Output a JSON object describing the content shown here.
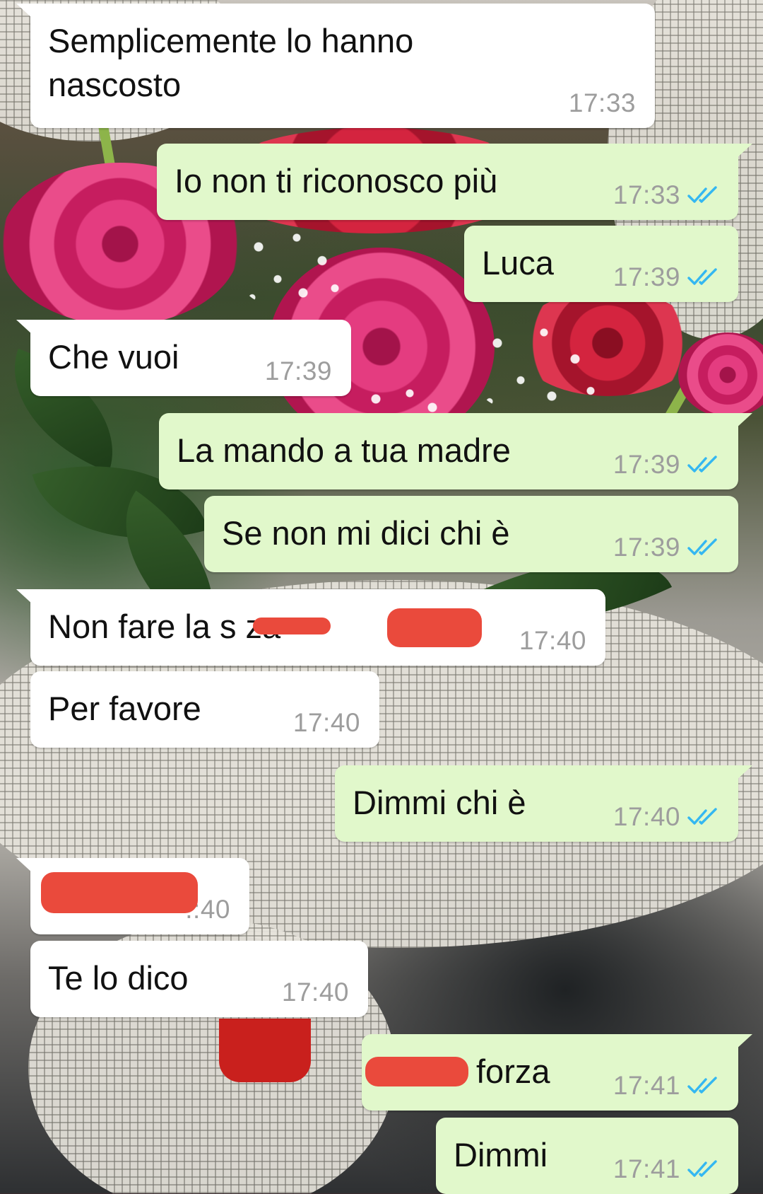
{
  "colors": {
    "incoming_bubble": "#ffffff",
    "outgoing_bubble": "#e1f8cb",
    "timestamp": "#9d9d9d",
    "read_ticks": "#34b7f1",
    "redaction": "#ea4a3c"
  },
  "icons": {
    "read_receipt": "double-check-icon"
  },
  "messages": [
    {
      "dir": "in",
      "text": "Semplicemente lo hanno\nnascosto",
      "time": "17:33"
    },
    {
      "dir": "out",
      "text": "Io non ti riconosco più",
      "time": "17:33",
      "read": true
    },
    {
      "dir": "out",
      "text": "Luca",
      "time": "17:39",
      "read": true
    },
    {
      "dir": "in",
      "text": "Che vuoi",
      "time": "17:39"
    },
    {
      "dir": "out",
      "text": "La mando a tua madre",
      "time": "17:39",
      "read": true
    },
    {
      "dir": "out",
      "text": "Se non mi dici chi è",
      "time": "17:39",
      "read": true
    },
    {
      "dir": "in",
      "text": "Non fare la s      za",
      "time": "17:40",
      "redacted": true
    },
    {
      "dir": "in",
      "text": "Per favore",
      "time": "17:40"
    },
    {
      "dir": "out",
      "text": "Dimmi chi è",
      "time": "17:40",
      "read": true
    },
    {
      "dir": "in",
      "text": "",
      "time": ".:40",
      "redacted": true
    },
    {
      "dir": "in",
      "text": "Te lo dico",
      "time": "17:40"
    },
    {
      "dir": "out",
      "text": "forza",
      "time": "17:41",
      "read": true,
      "redacted": true
    },
    {
      "dir": "out",
      "text": "Dimmi",
      "time": "17:41",
      "read": true
    }
  ]
}
